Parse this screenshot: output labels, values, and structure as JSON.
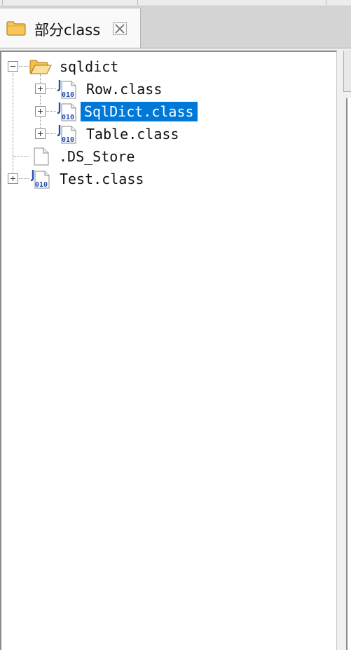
{
  "tab": {
    "title": "部分class",
    "icon": "folder-icon",
    "close_icon": "close-icon"
  },
  "tree": {
    "items": [
      {
        "label": "sqldict",
        "icon": "folder-open-icon",
        "expander": "collapse",
        "level": 0
      },
      {
        "label": "Row.class",
        "icon": "class-file-icon",
        "expander": "expand",
        "level": 1
      },
      {
        "label": "SqlDict.class",
        "icon": "class-file-icon",
        "expander": "expand",
        "level": 1,
        "selected": true
      },
      {
        "label": "Table.class",
        "icon": "class-file-icon",
        "expander": "expand",
        "level": 1
      },
      {
        "label": ".DS_Store",
        "icon": "file-icon",
        "expander": "none",
        "level": 0
      },
      {
        "label": "Test.class",
        "icon": "class-file-icon",
        "expander": "expand",
        "level": 0
      }
    ]
  },
  "colors": {
    "selection": "#0078d7",
    "folder": "#e8b648",
    "class_badge": "#1f4fb0"
  }
}
